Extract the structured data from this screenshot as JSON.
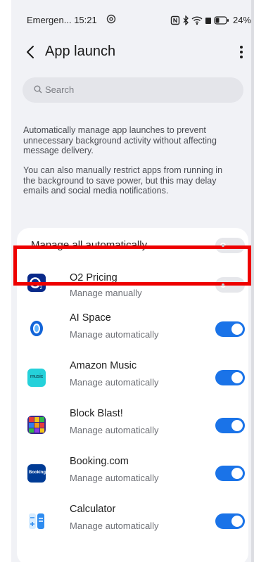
{
  "status_bar": {
    "left_text": "Emergen... 15:21",
    "battery": "24%"
  },
  "header": {
    "title": "App launch"
  },
  "search": {
    "placeholder": "Search"
  },
  "description": {
    "para1": "Automatically manage app launches to prevent unnecessary background activity without affecting message delivery.",
    "para2": "You can also manually restrict apps from running in the background to save power, but this may delay emails and social media notifications."
  },
  "manage_all": {
    "label": "Manage all automatically",
    "enabled": false
  },
  "apps": [
    {
      "name": "O2 Pricing",
      "status": "Manage manually",
      "enabled": false,
      "icon": "o2-icon"
    },
    {
      "name": "AI Space",
      "status": "Manage automatically",
      "enabled": true,
      "icon": "ai-space-icon"
    },
    {
      "name": "Amazon Music",
      "status": "Manage automatically",
      "enabled": true,
      "icon": "amazon-music-icon",
      "icon_text": "music"
    },
    {
      "name": "Block Blast!",
      "status": "Manage automatically",
      "enabled": true,
      "icon": "block-blast-icon"
    },
    {
      "name": "Booking.com",
      "status": "Manage automatically",
      "enabled": true,
      "icon": "booking-icon",
      "icon_text": "Booking"
    },
    {
      "name": "Calculator",
      "status": "Manage automatically",
      "enabled": true,
      "icon": "calculator-icon"
    }
  ],
  "colors": {
    "accent": "#1a73e8",
    "highlight": "#ee0000"
  }
}
